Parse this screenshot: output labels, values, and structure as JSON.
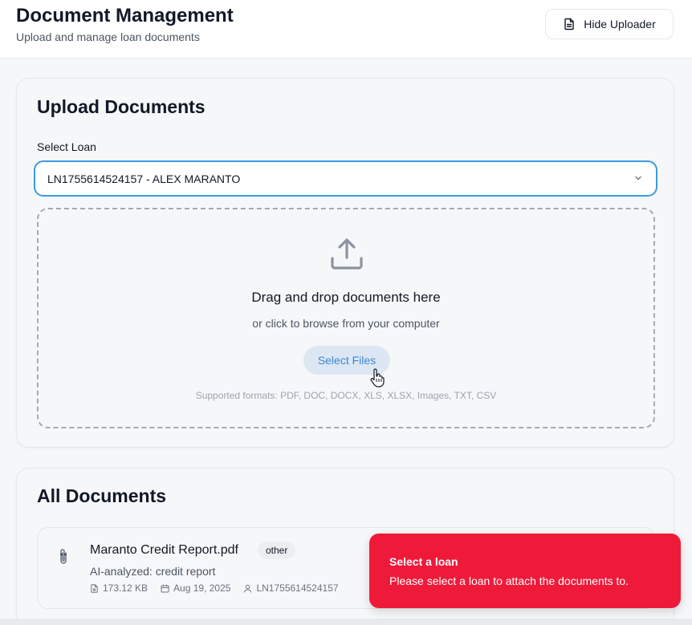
{
  "header": {
    "title": "Document Management",
    "subtitle": "Upload and manage loan documents",
    "hide_uploader_label": "Hide Uploader"
  },
  "upload": {
    "title": "Upload Documents",
    "select_label": "Select Loan",
    "selected_loan": "LN1755614524157 - ALEX MARANTO",
    "dropzone": {
      "title": "Drag and drop documents here",
      "subtitle": "or click to browse from your computer",
      "button_label": "Select Files",
      "formats": "Supported formats: PDF, DOC, DOCX, XLS, XLSX, Images, TXT, CSV"
    }
  },
  "documents": {
    "title": "All Documents",
    "items": [
      {
        "name": "Maranto Credit Report.pdf",
        "badge": "other",
        "analysis": "AI-analyzed: credit report",
        "size": "173.12 KB",
        "date": "Aug 19, 2025",
        "loan": "LN1755614524157"
      }
    ]
  },
  "toast": {
    "title": "Select a loan",
    "description": "Please select a loan to attach the documents to.",
    "color": "#ef1a3a"
  },
  "colors": {
    "accent": "#3b9be0",
    "page_bg": "#f6f7f8"
  }
}
